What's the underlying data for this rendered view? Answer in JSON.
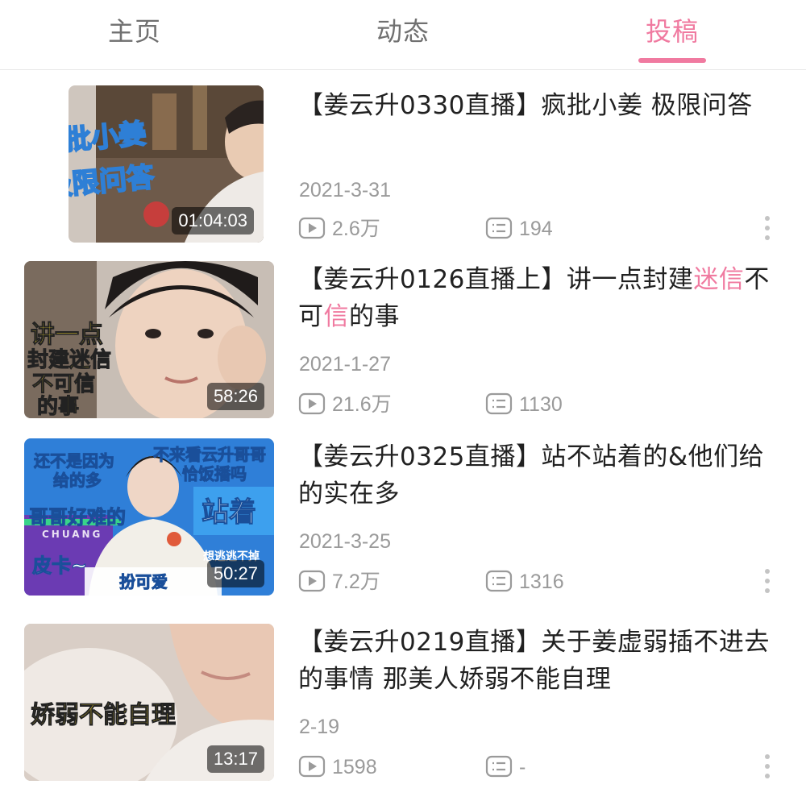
{
  "tabs": [
    {
      "label": "主页"
    },
    {
      "label": "动态"
    },
    {
      "label": "投稿"
    }
  ],
  "videos": [
    {
      "title_parts": [
        "【姜云升0330直播】疯批小姜  极限问答"
      ],
      "date": "2021-3-31",
      "plays": "2.6万",
      "comments": "194",
      "duration": "01:04:03",
      "thumb_text": [
        "疯批小姜",
        "极限问答"
      ]
    },
    {
      "title_parts": [
        "【姜云升0126直播上】讲一点封建",
        "迷信",
        "不可",
        "信",
        "的事"
      ],
      "date": "2021-1-27",
      "plays": "21.6万",
      "comments": "1130",
      "duration": "58:26",
      "thumb_text": [
        "讲一点",
        "封建迷信",
        "不可信",
        "的事"
      ]
    },
    {
      "title_parts": [
        "【姜云升0325直播】站不站着的&他们给的实在多"
      ],
      "date": "2021-3-25",
      "plays": "7.2万",
      "comments": "1316",
      "duration": "50:27",
      "thumb_text": [
        "还不是因为",
        "给的多",
        "不来看云升哥哥",
        "恰饭播吗",
        "哥哥好难的",
        "站着",
        "皮卡~",
        "扮可爱",
        "想逃逃不掉",
        "CHUANG"
      ]
    },
    {
      "title_parts": [
        "【姜云升0219直播】关于姜虚弱插不进去的事情  那美人娇弱不能自理"
      ],
      "date": "2-19",
      "plays": "1598",
      "comments": "-",
      "duration": "13:17",
      "thumb_text": [
        "娇弱不能自理"
      ]
    }
  ],
  "colors": {
    "accent": "#f07aa0",
    "meta": "#9a9a9a"
  },
  "icons": [
    "play-count-icon",
    "comment-count-icon",
    "more-options-icon"
  ]
}
